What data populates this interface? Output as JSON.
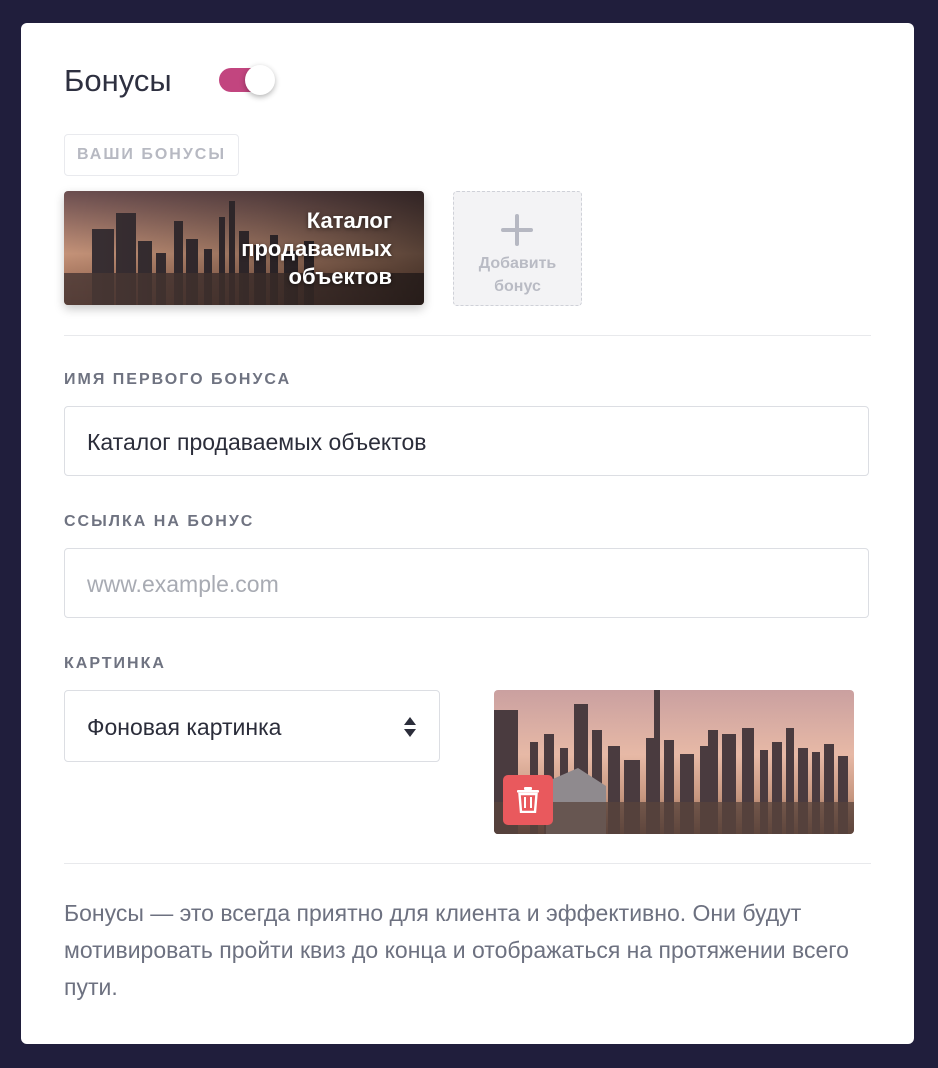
{
  "header": {
    "title": "Бонусы",
    "toggle_on": true
  },
  "bonuses": {
    "section_tag": "ВАШИ БОНУСЫ",
    "items": [
      {
        "label": "Каталог продаваемых объектов"
      }
    ],
    "add_label_line1": "Добавить",
    "add_label_line2": "бонус"
  },
  "form": {
    "name_label": "ИМЯ ПЕРВОГО БОНУСА",
    "name_value": "Каталог продаваемых объектов",
    "link_label": "ССЫЛКА НА БОНУС",
    "link_placeholder": "www.example.com",
    "image_label": "КАРТИНКА",
    "image_select_value": "Фоновая картинка"
  },
  "help_text": "Бонусы — это всегда приятно для клиента и эффективно. Они будут мотивировать пройти квиз до конца и отображаться на протяжении всего пути.",
  "colors": {
    "background": "#201e3c",
    "toggle_on": "#c2457f",
    "delete_button": "#e9595d"
  },
  "icons": {
    "add": "plus-icon",
    "select": "sort-arrows-icon",
    "delete": "trash-icon"
  }
}
